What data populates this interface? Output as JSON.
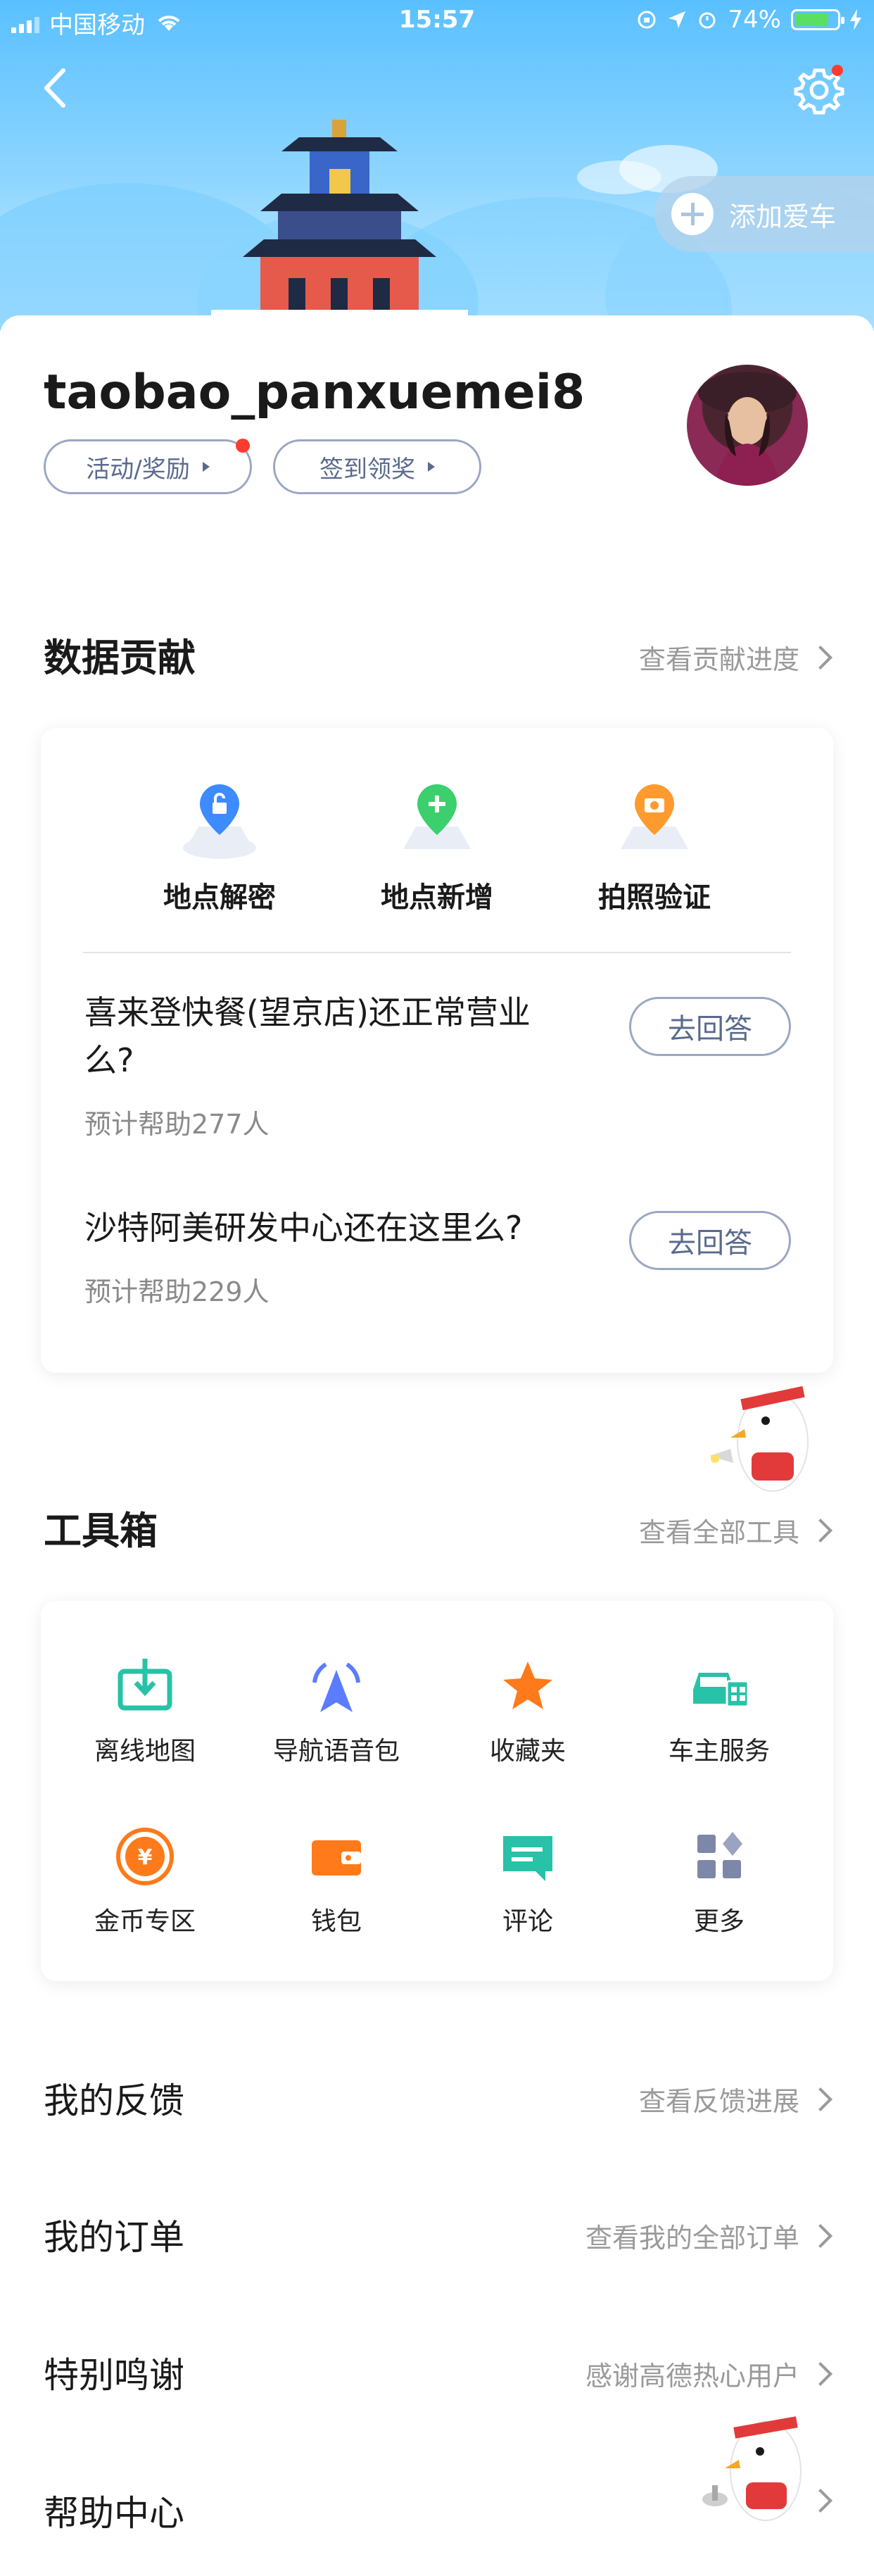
{
  "status_bar": {
    "carrier": "中国移动",
    "time": "15:57",
    "battery": "74%"
  },
  "header": {
    "add_car_label": "添加爱车"
  },
  "profile": {
    "username": "taobao_panxuemei8",
    "activity_label": "活动/奖励",
    "signin_label": "签到领奖"
  },
  "contribution": {
    "title": "数据贡献",
    "link": "查看贡献进度",
    "actions": [
      {
        "label": "地点解密",
        "icon": "unlock-pin-icon",
        "color": "#3d8bff"
      },
      {
        "label": "地点新增",
        "icon": "add-pin-icon",
        "color": "#3ccf6d"
      },
      {
        "label": "拍照验证",
        "icon": "camera-pin-icon",
        "color": "#ff9a2e"
      }
    ],
    "questions": [
      {
        "title": "喜来登快餐(望京店)还正常营业么?",
        "sub": "预计帮助277人",
        "button": "去回答"
      },
      {
        "title": "沙特阿美研发中心还在这里么?",
        "sub": "预计帮助229人",
        "button": "去回答"
      }
    ]
  },
  "toolbox": {
    "title": "工具箱",
    "link": "查看全部工具",
    "tools": [
      {
        "label": "离线地图",
        "icon": "offline-map-icon",
        "color": "#27c2a7"
      },
      {
        "label": "导航语音包",
        "icon": "voice-pack-icon",
        "color": "#5b7cff"
      },
      {
        "label": "收藏夹",
        "icon": "star-icon",
        "color": "#ff7a1a"
      },
      {
        "label": "车主服务",
        "icon": "car-service-icon",
        "color": "#27c2a7"
      },
      {
        "label": "金币专区",
        "icon": "coin-icon",
        "color": "#ff7a1a"
      },
      {
        "label": "钱包",
        "icon": "wallet-icon",
        "color": "#ff7a1a"
      },
      {
        "label": "评论",
        "icon": "comment-icon",
        "color": "#27c2a7"
      },
      {
        "label": "更多",
        "icon": "more-grid-icon",
        "color": "#7d87a8"
      }
    ]
  },
  "menu": [
    {
      "title": "我的反馈",
      "link": "查看反馈进展"
    },
    {
      "title": "我的订单",
      "link": "查看我的全部订单"
    },
    {
      "title": "特别鸣谢",
      "link": "感谢高德热心用户"
    },
    {
      "title": "帮助中心",
      "link": ""
    }
  ]
}
